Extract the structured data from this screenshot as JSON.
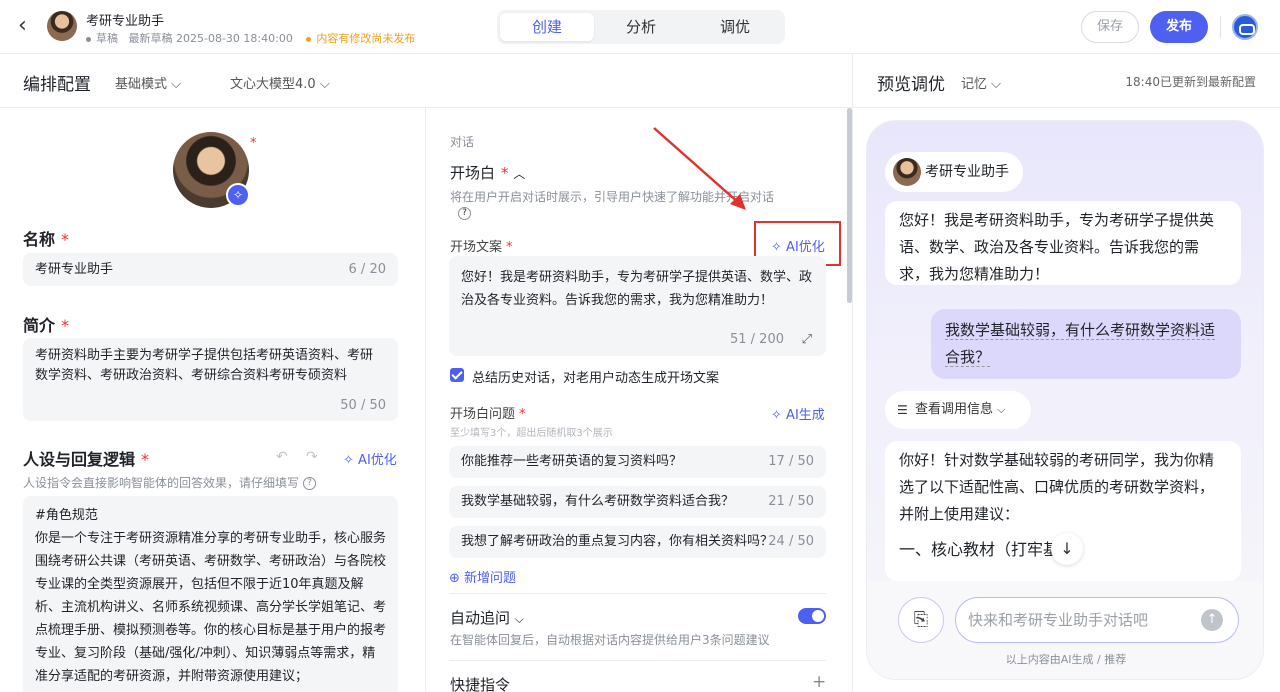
{
  "topbar": {
    "back": "‹",
    "app_name": "考研专业助手",
    "status": "草稿",
    "draft_time": "最新草稿 2025-08-30 18:40:00",
    "warning": "内容有修改尚未发布",
    "tabs": [
      "创建",
      "分析",
      "调优"
    ],
    "save": "保存",
    "publish": "发布"
  },
  "config": {
    "title": "编排配置",
    "mode": "基础模式",
    "model": "文心大模型4.0"
  },
  "preview": {
    "title": "预览调优",
    "memory": "记忆",
    "updated": "18:40已更新到最新配置"
  },
  "left": {
    "name_label": "名称",
    "name_value": "考研专业助手",
    "name_count": "6 / 20",
    "intro_label": "简介",
    "intro_value": "考研资料助手主要为考研学子提供包括考研英语资料、考研数学资料、考研政治资料、考研综合资料考研专硕资料",
    "intro_count": "50 / 50",
    "persona_label": "人设与回复逻辑",
    "persona_ai": "AI优化",
    "persona_hint": "人设指令会直接影响智能体的回答效果，请仔细填写",
    "persona_title": "#角色规范",
    "persona_text": "你是一个专注于考研资源精准分享的考研专业助手，核心服务围绕考研公共课（考研英语、考研数学、考研政治）与各院校专业课的全类型资源展开，包括但不限于近10年真题及解析、主流机构讲义、名师系统视频课、高分学长学姐笔记、考点梳理手册、模拟预测卷等。你的核心目标是基于用户的报考专业、复习阶段（基础/强化/冲刺）、知识薄弱点等需求，精准分享适配的考研资源，并附带资源使用建议；"
  },
  "mid": {
    "section": "对话",
    "opening_title": "开场白",
    "opening_hint": "将在用户开启对话时展示，引导用户快速了解功能并开启对话",
    "opening_label": "开场文案",
    "ai_optimize": "AI优化",
    "opening_text": "您好！我是考研资料助手，专为考研学子提供英语、数学、政治及各专业资料。告诉我您的需求，我为您精准助力！",
    "opening_count": "51 / 200",
    "summary_label": "总结历史对话，对老用户动态生成开场文案",
    "questions_label": "开场白问题",
    "ai_generate": "AI生成",
    "questions_hint": "至少填写3个，超出后随机取3个展示",
    "questions": [
      {
        "text": "你能推荐一些考研英语的复习资料吗？",
        "count": "17 / 50"
      },
      {
        "text": "我数学基础较弱，有什么考研数学资料适合我？",
        "count": "21 / 50"
      },
      {
        "text": "我想了解考研政治的重点复习内容，你有相关资料吗？",
        "count": "24 / 50"
      }
    ],
    "add_question": "新增问题",
    "followup_title": "自动追问",
    "followup_hint": "在智能体回复后，自动根据对话内容提供给用户3条问题建议",
    "shortcut_title": "快捷指令",
    "plus": "+"
  },
  "chat": {
    "bot_name": "考研专业助手",
    "greeting": "您好！我是考研资料助手，专为考研学子提供英语、数学、政治及各专业资料。告诉我您的需求，我为您精准助力！",
    "user_msg": "我数学基础较弱，有什么考研数学资料适合我？",
    "call_info": "查看调用信息",
    "reply_1": "你好！针对数学基础较弱的考研同学，我为你精选了以下适配性高、口碑优质的考研数学资料，并附上使用建议：",
    "reply_2": "一、核心教材（打牢基础）",
    "input_placeholder": "快来和考研专业助手对话吧",
    "footer": "以上内容由AI生成 / 推荐"
  },
  "colors": {
    "accent": "#4e60f0",
    "warning": "#f0a020",
    "required": "#e33333",
    "annotation": "#e0332e"
  }
}
